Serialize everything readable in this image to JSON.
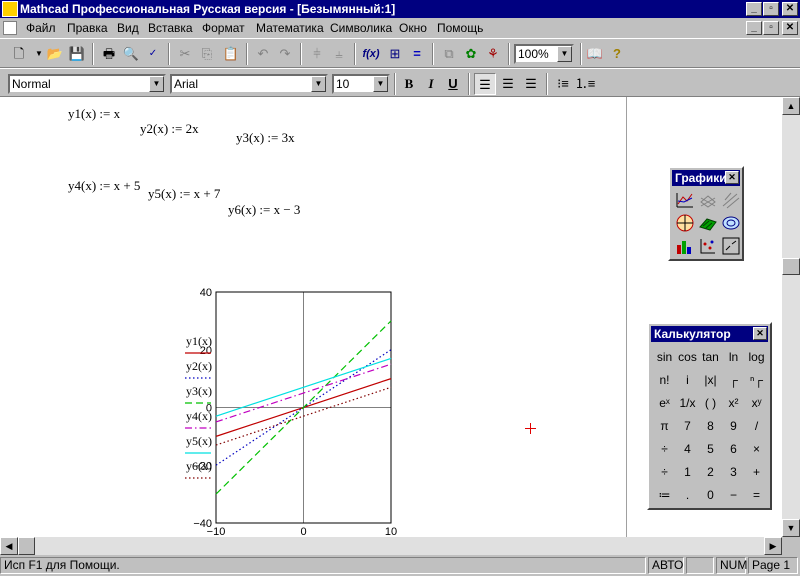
{
  "titlebar": {
    "title": "Mathcad Профессиональная Русская версия - [Безымянный:1]"
  },
  "menubar": {
    "items": [
      "Файл",
      "Правка",
      "Вид",
      "Вставка",
      "Формат",
      "Математика",
      "Символика",
      "Окно",
      "Помощь"
    ]
  },
  "toolbar": {
    "zoom": "100%"
  },
  "format_bar": {
    "style": "Normal",
    "font": "Arial",
    "size": "10",
    "bold": "B",
    "italic": "I",
    "underline": "U"
  },
  "worksheet": {
    "expressions": [
      "y1(x) := x",
      "y2(x) := 2x",
      "y3(x) := 3x",
      "y4(x) := x + 5",
      "y5(x) := x + 7",
      "y6(x) := x − 3"
    ]
  },
  "chart_data": {
    "type": "line",
    "xlim": [
      -10,
      10
    ],
    "ylim": [
      -40,
      40
    ],
    "x_ticks": [
      "−10",
      "0",
      "10"
    ],
    "y_ticks": [
      "40",
      "20",
      "0",
      "−20",
      "−40"
    ],
    "series": [
      {
        "name": "y1(x)",
        "x": [
          -10,
          10
        ],
        "y": [
          -10,
          10
        ],
        "color": "#c00000",
        "dash": "solid"
      },
      {
        "name": "y2(x)",
        "x": [
          -10,
          10
        ],
        "y": [
          -20,
          20
        ],
        "color": "#0000c0",
        "dash": "dot"
      },
      {
        "name": "y3(x)",
        "x": [
          -10,
          10
        ],
        "y": [
          -30,
          30
        ],
        "color": "#00c000",
        "dash": "dash"
      },
      {
        "name": "y4(x)",
        "x": [
          -10,
          10
        ],
        "y": [
          -5,
          15
        ],
        "color": "#c000c0",
        "dash": "dashdot"
      },
      {
        "name": "y5(x)",
        "x": [
          -10,
          10
        ],
        "y": [
          -3,
          17
        ],
        "color": "#00e0e0",
        "dash": "solid"
      },
      {
        "name": "y6(x)",
        "x": [
          -10,
          10
        ],
        "y": [
          -13,
          7
        ],
        "color": "#800000",
        "dash": "dot"
      }
    ]
  },
  "graph_palette": {
    "title": "Графики"
  },
  "calc_palette": {
    "title": "Калькулятор",
    "keys": [
      [
        "sin",
        "cos",
        "tan",
        "ln",
        "log"
      ],
      [
        "n!",
        "i",
        "|x|",
        "┌",
        "ⁿ┌"
      ],
      [
        "eˣ",
        "1/x",
        "( )",
        "x²",
        "xʸ"
      ],
      [
        "π",
        "7",
        "8",
        "9",
        "/"
      ],
      [
        "÷",
        "4",
        "5",
        "6",
        "×"
      ],
      [
        "÷",
        "1",
        "2",
        "3",
        "+"
      ],
      [
        "≔",
        ".",
        "0",
        "−",
        "="
      ]
    ]
  },
  "statusbar": {
    "help": "Исп F1 для Помощи.",
    "mode": "АВТО",
    "blank": "",
    "num": "NUM",
    "page": "Page 1"
  }
}
